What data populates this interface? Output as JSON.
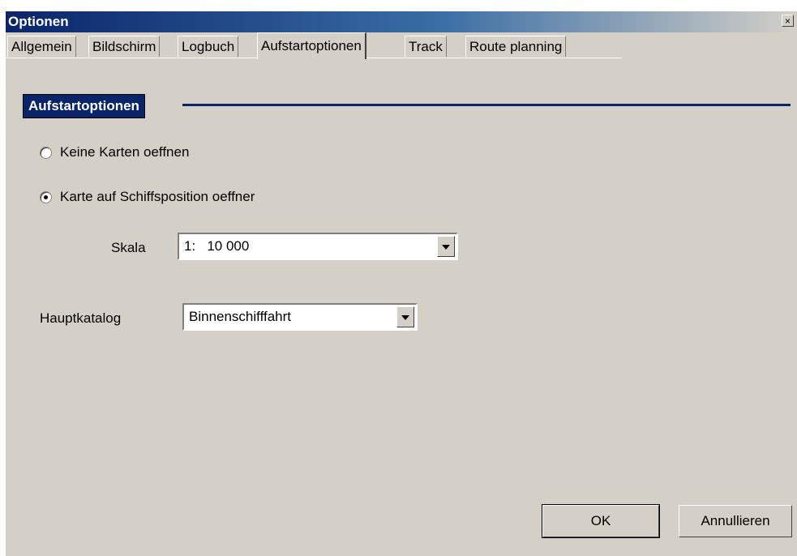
{
  "window": {
    "title": "Optionen",
    "close_glyph": "×"
  },
  "tabs": [
    {
      "label": "Allgemein"
    },
    {
      "label": "Bildschirm"
    },
    {
      "label": "Logbuch"
    },
    {
      "label": "Aufstartoptionen"
    },
    {
      "label": "Track"
    },
    {
      "label": "Route planning"
    }
  ],
  "active_tab": "Aufstartoptionen",
  "group": {
    "label": "Aufstartoptionen"
  },
  "startup": {
    "option_none": {
      "label": "Keine Karten oeffnen",
      "checked": false
    },
    "option_ship": {
      "label": "Karte auf Schiffsposition oeffner",
      "checked": true
    }
  },
  "scale": {
    "label": "Skala",
    "value": "1:   10 000"
  },
  "catalog": {
    "label": "Hauptkatalog",
    "value": "Binnenschifffahrt"
  },
  "buttons": {
    "ok": "OK",
    "cancel": "Annullieren"
  },
  "colors": {
    "title_bar": "#0a246a",
    "dialog_face": "#d4d0c8"
  }
}
